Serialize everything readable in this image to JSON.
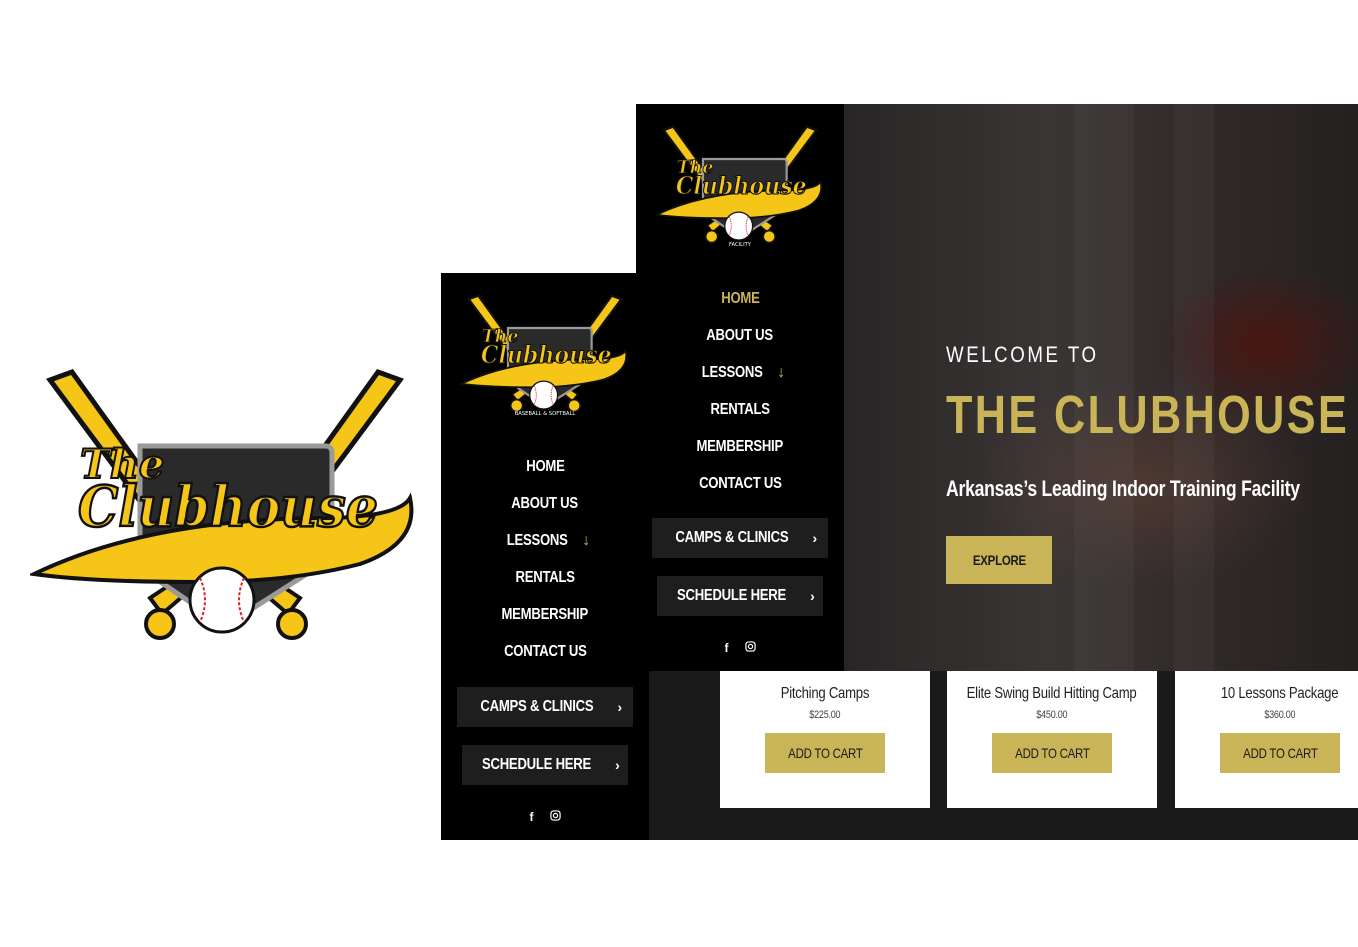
{
  "brand": {
    "logo_top": "The",
    "logo_main": "Clubhouse",
    "logo_tagline_1": "BASEBALL & SOFTBALL",
    "logo_tagline_2": "FACILITY",
    "colors": {
      "gold": "#c9b458",
      "logo_yellow": "#f5c518",
      "black": "#000000"
    }
  },
  "nav": {
    "items": [
      {
        "label": "HOME"
      },
      {
        "label": "ABOUT US"
      },
      {
        "label": "LESSONS",
        "arrow": "↓"
      },
      {
        "label": "RENTALS"
      },
      {
        "label": "MEMBERSHIP"
      },
      {
        "label": "CONTACT US"
      }
    ],
    "cta_camps": "CAMPS & CLINICS",
    "cta_schedule": "SCHEDULE HERE",
    "social_icons": [
      "facebook-icon",
      "instagram-icon"
    ]
  },
  "hero": {
    "welcome": "WELCOME TO",
    "title": "THE CLUBHOUSE",
    "subtitle": "Arkansas’s Leading Indoor Training Facility",
    "button": "EXPLORE"
  },
  "products": [
    {
      "name": "Pitching Camps",
      "price": "$225.00",
      "button": "ADD TO CART"
    },
    {
      "name": "Elite Swing Build Hitting Camp",
      "price": "$450.00",
      "button": "ADD TO CART"
    },
    {
      "name": "10 Lessons Package",
      "price": "$360.00",
      "button": "ADD TO CART"
    }
  ]
}
